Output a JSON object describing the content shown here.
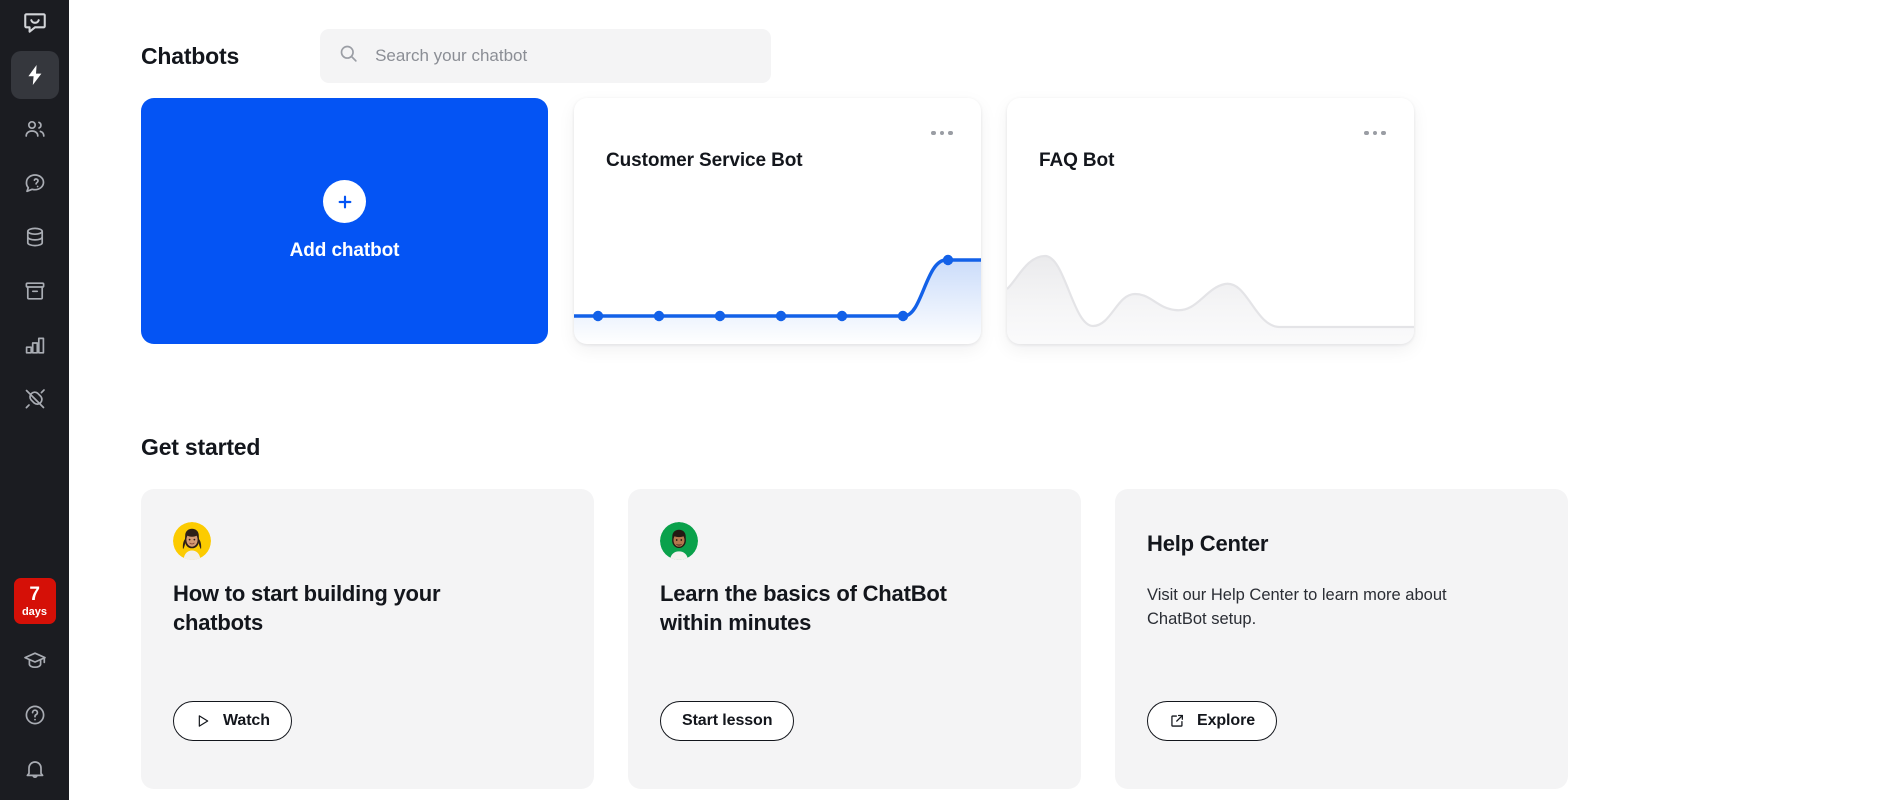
{
  "sidebar": {
    "logo_icon": "chatbot-logo-icon",
    "items": [
      {
        "icon": "lightning-bolt-icon",
        "name": "chatbots",
        "active": true
      },
      {
        "icon": "users-icon",
        "name": "users",
        "active": false
      },
      {
        "icon": "chat-question-icon",
        "name": "archives",
        "active": false
      },
      {
        "icon": "database-icon",
        "name": "knowledge-base",
        "active": false
      },
      {
        "icon": "archive-box-icon",
        "name": "archive",
        "active": false
      },
      {
        "icon": "bar-chart-icon",
        "name": "reports",
        "active": false
      },
      {
        "icon": "plug-icon",
        "name": "integrations",
        "active": false
      }
    ],
    "trial": {
      "number": "7",
      "unit": "days"
    },
    "bottom_items": [
      {
        "icon": "graduation-cap-icon",
        "name": "academy"
      },
      {
        "icon": "question-circle-icon",
        "name": "help"
      },
      {
        "icon": "bell-icon",
        "name": "notifications"
      }
    ]
  },
  "header": {
    "title": "Chatbots",
    "search": {
      "placeholder": "Search your chatbot",
      "value": "",
      "icon": "search-icon"
    }
  },
  "chatbots": {
    "add_card": {
      "label": "Add chatbot",
      "icon": "plus-icon",
      "color": "#0454f4"
    },
    "cards": [
      {
        "name": "Customer Service Bot",
        "menu_icon": "more-horizontal-icon",
        "chart": {
          "type": "line",
          "style": "sparkline-blue",
          "color": "#1361e8",
          "points": [
            0,
            0,
            0,
            0,
            0,
            0,
            1,
            1
          ],
          "marker_count": 7
        }
      },
      {
        "name": "FAQ Bot",
        "menu_icon": "more-horizontal-icon",
        "chart": {
          "type": "area",
          "style": "sparkline-grey",
          "color": "#f0f0f1",
          "points": [
            0.35,
            0.75,
            0.1,
            0.05,
            0.45,
            0.3,
            0.25,
            0.6,
            0.05,
            0.02
          ],
          "marker_count": 0
        }
      }
    ]
  },
  "get_started": {
    "title": "Get started",
    "cards": [
      {
        "avatar": "avatar-woman-yellow",
        "avatar_bg": "#fccb00",
        "heading": "How to start building your chatbots",
        "description": "",
        "button": {
          "label": "Watch",
          "icon": "play-icon"
        }
      },
      {
        "avatar": "avatar-man-green",
        "avatar_bg": "#0aa14b",
        "heading": "Learn the basics of ChatBot within minutes",
        "description": "",
        "button": {
          "label": "Start lesson",
          "icon": ""
        }
      },
      {
        "avatar": "",
        "avatar_bg": "",
        "heading": "Help Center",
        "description": "Visit our Help Center to learn more about ChatBot setup.",
        "button": {
          "label": "Explore",
          "icon": "external-link-icon"
        }
      }
    ]
  }
}
